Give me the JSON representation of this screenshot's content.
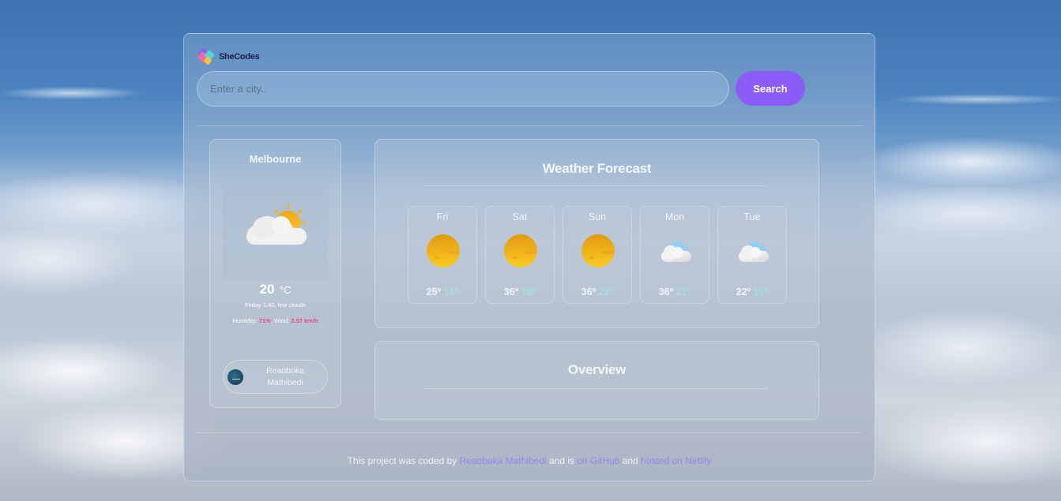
{
  "brand": {
    "name": "SheCodes"
  },
  "search": {
    "placeholder": "Enter a city..",
    "value": "",
    "button_label": "Search"
  },
  "current": {
    "city": "Melbourne",
    "icon": "few-clouds-day-icon",
    "temperature": "20",
    "unit": "°C",
    "description": "Friday 1:40, few clouds",
    "humidity_label": "Humidity:",
    "humidity_value": "71%",
    "wind_label": "Wind:",
    "wind_value": "2.57 km/h",
    "author": {
      "name_line1": "Reaoboka",
      "name_line2": "Mathibedi"
    }
  },
  "forecast": {
    "title": "Weather Forecast",
    "days": [
      {
        "day": "Fri",
        "icon": "sun-icon",
        "max": "25º",
        "min": "14º"
      },
      {
        "day": "Sat",
        "icon": "sun-icon",
        "max": "36º",
        "min": "19º"
      },
      {
        "day": "Sun",
        "icon": "sun-icon",
        "max": "36º",
        "min": "22º"
      },
      {
        "day": "Mon",
        "icon": "cloud-icon",
        "max": "36º",
        "min": "21º"
      },
      {
        "day": "Tue",
        "icon": "cloud-icon",
        "max": "22º",
        "min": "17º"
      }
    ]
  },
  "overview": {
    "title": "Overview"
  },
  "footer": {
    "text1": "This project was coded by ",
    "link1": "Reaoboka Mathibedi",
    "text2": " and is ",
    "link2": "on GitHub",
    "text3": " and ",
    "link3": "hosted on Netlify"
  },
  "colors": {
    "accent": "#8b5cf6",
    "highlight": "#f0457a",
    "min_temp": "#9fe0e6",
    "link": "#9a82f0"
  }
}
